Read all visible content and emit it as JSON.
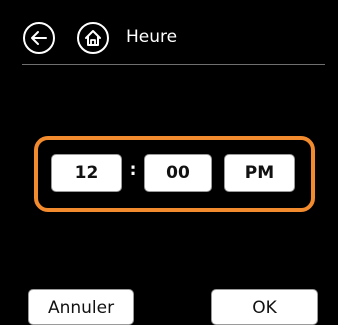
{
  "header": {
    "title": "Heure",
    "back_icon": "arrow-left-icon",
    "home_icon": "home-icon"
  },
  "time": {
    "hour": "12",
    "separator": ":",
    "minute": "00",
    "period": "PM"
  },
  "actions": {
    "cancel_label": "Annuler",
    "ok_label": "OK"
  },
  "colors": {
    "background": "#000000",
    "accent": "#f28a2e",
    "divider": "#6f6f6f"
  }
}
